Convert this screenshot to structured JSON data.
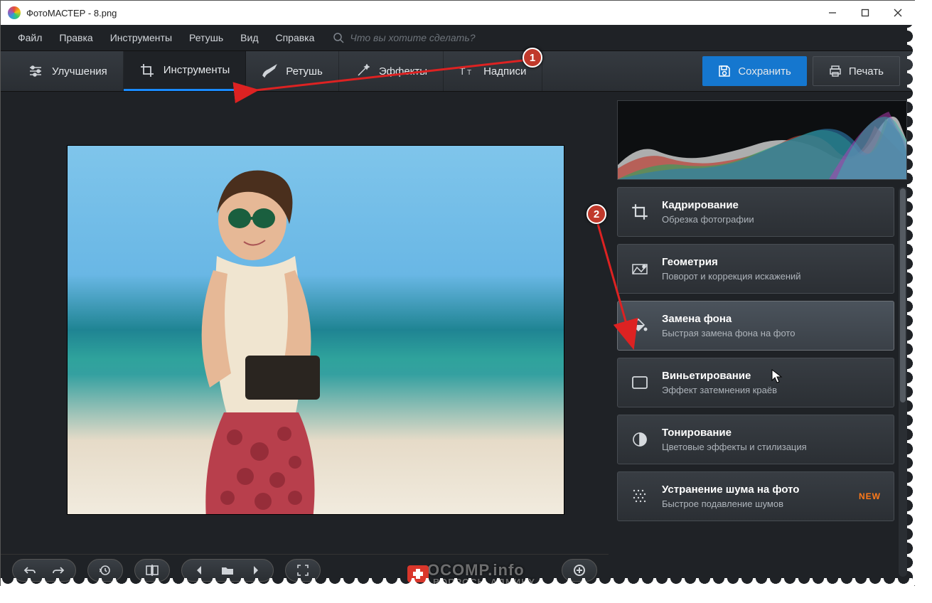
{
  "window": {
    "title": "ФотоМАСТЕР - 8.png"
  },
  "menu": {
    "file": "Файл",
    "edit": "Правка",
    "tools": "Инструменты",
    "retouch": "Ретушь",
    "view": "Вид",
    "help": "Справка"
  },
  "search": {
    "placeholder": "Что вы хотите сделать?"
  },
  "tabs": {
    "enhance": "Улучшения",
    "tools": "Инструменты",
    "retouch": "Ретушь",
    "effects": "Эффекты",
    "captions": "Надписи"
  },
  "actions": {
    "save": "Сохранить",
    "print": "Печать"
  },
  "tools_panel": {
    "crop": {
      "title": "Кадрирование",
      "sub": "Обрезка фотографии"
    },
    "geometry": {
      "title": "Геометрия",
      "sub": "Поворот и коррекция искажений"
    },
    "replace_bg": {
      "title": "Замена фона",
      "sub": "Быстрая замена фона на фото"
    },
    "vignette": {
      "title": "Виньетирование",
      "sub": "Эффект затемнения краёв"
    },
    "toning": {
      "title": "Тонирование",
      "sub": "Цветовые эффекты и стилизация"
    },
    "denoise": {
      "title": "Устранение шума на фото",
      "sub": "Быстрое подавление шумов",
      "badge": "NEW"
    }
  },
  "annotations": {
    "marker1": "1",
    "marker2": "2"
  },
  "watermark": {
    "line1": "OCOMP.info",
    "line2": "ВОПРОСЫ АДМИНУ"
  }
}
